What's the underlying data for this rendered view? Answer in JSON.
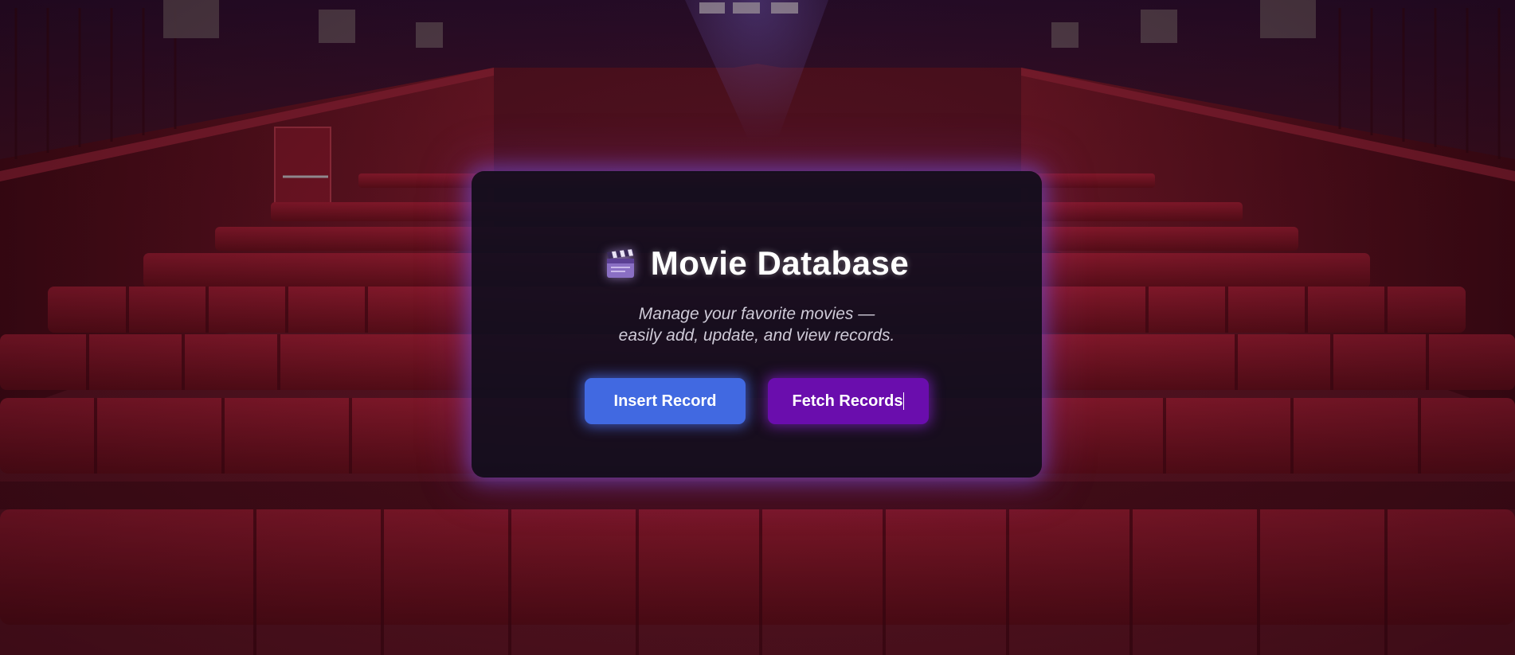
{
  "app": {
    "title": "Movie Database",
    "icon": "clapperboard-icon",
    "subtitle_line1": "Manage your favorite movies —",
    "subtitle_line2": "easily add, update, and view records."
  },
  "actions": {
    "insert_label": "Insert Record",
    "fetch_label": "Fetch Records"
  },
  "colors": {
    "insert_button": "#4169e1",
    "fetch_button": "#6a0dad",
    "card_background": "#110e1e",
    "glow": "#6e50dc"
  },
  "background": {
    "scene": "cinema-hall-red-seats"
  }
}
